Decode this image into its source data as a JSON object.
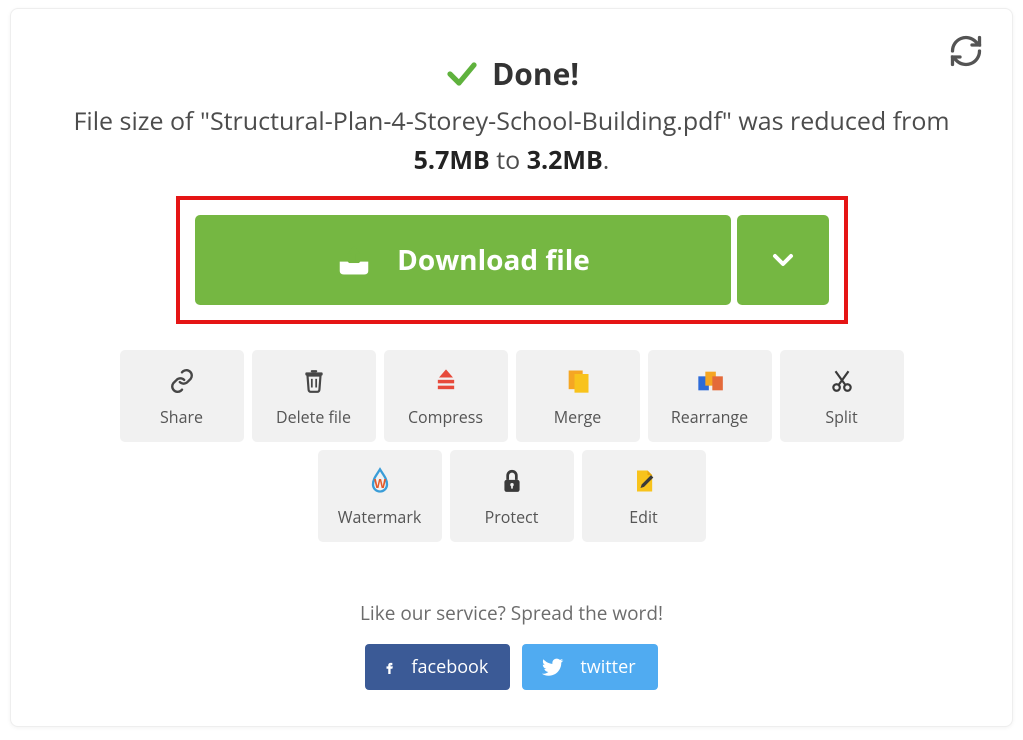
{
  "done_label": "Done!",
  "status": {
    "prefix": "File size of \"",
    "filename": "Structural-Plan-4-Storey-School-Building.pdf",
    "middle1": "\" was reduced from ",
    "from_size": "5.7MB",
    "middle2": " to ",
    "to_size": "3.2MB",
    "suffix": "."
  },
  "download_label": "Download file",
  "actions": {
    "share": "Share",
    "delete": "Delete file",
    "compress": "Compress",
    "merge": "Merge",
    "rearrange": "Rearrange",
    "split": "Split",
    "watermark": "Watermark",
    "protect": "Protect",
    "edit": "Edit"
  },
  "spread_text": "Like our service? Spread the word!",
  "social": {
    "facebook": "facebook",
    "twitter": "twitter"
  }
}
